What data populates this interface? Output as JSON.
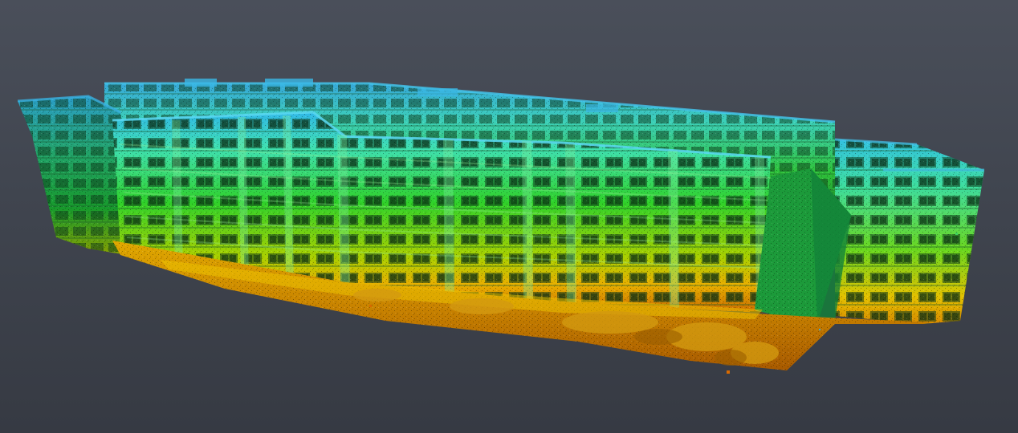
{
  "viewer": {
    "background_top": "#4a4f5a",
    "background_bottom": "#363a43"
  },
  "point_cloud": {
    "subject": "building-facade-scan",
    "colormap": "height",
    "colormap_stops": {
      "high": "#2fb7e6",
      "upper_mid": "#3fe0a8",
      "mid": "#2fd12a",
      "lower_mid": "#c8d400",
      "low": "#e89a00",
      "ground": "#c86a00"
    }
  }
}
